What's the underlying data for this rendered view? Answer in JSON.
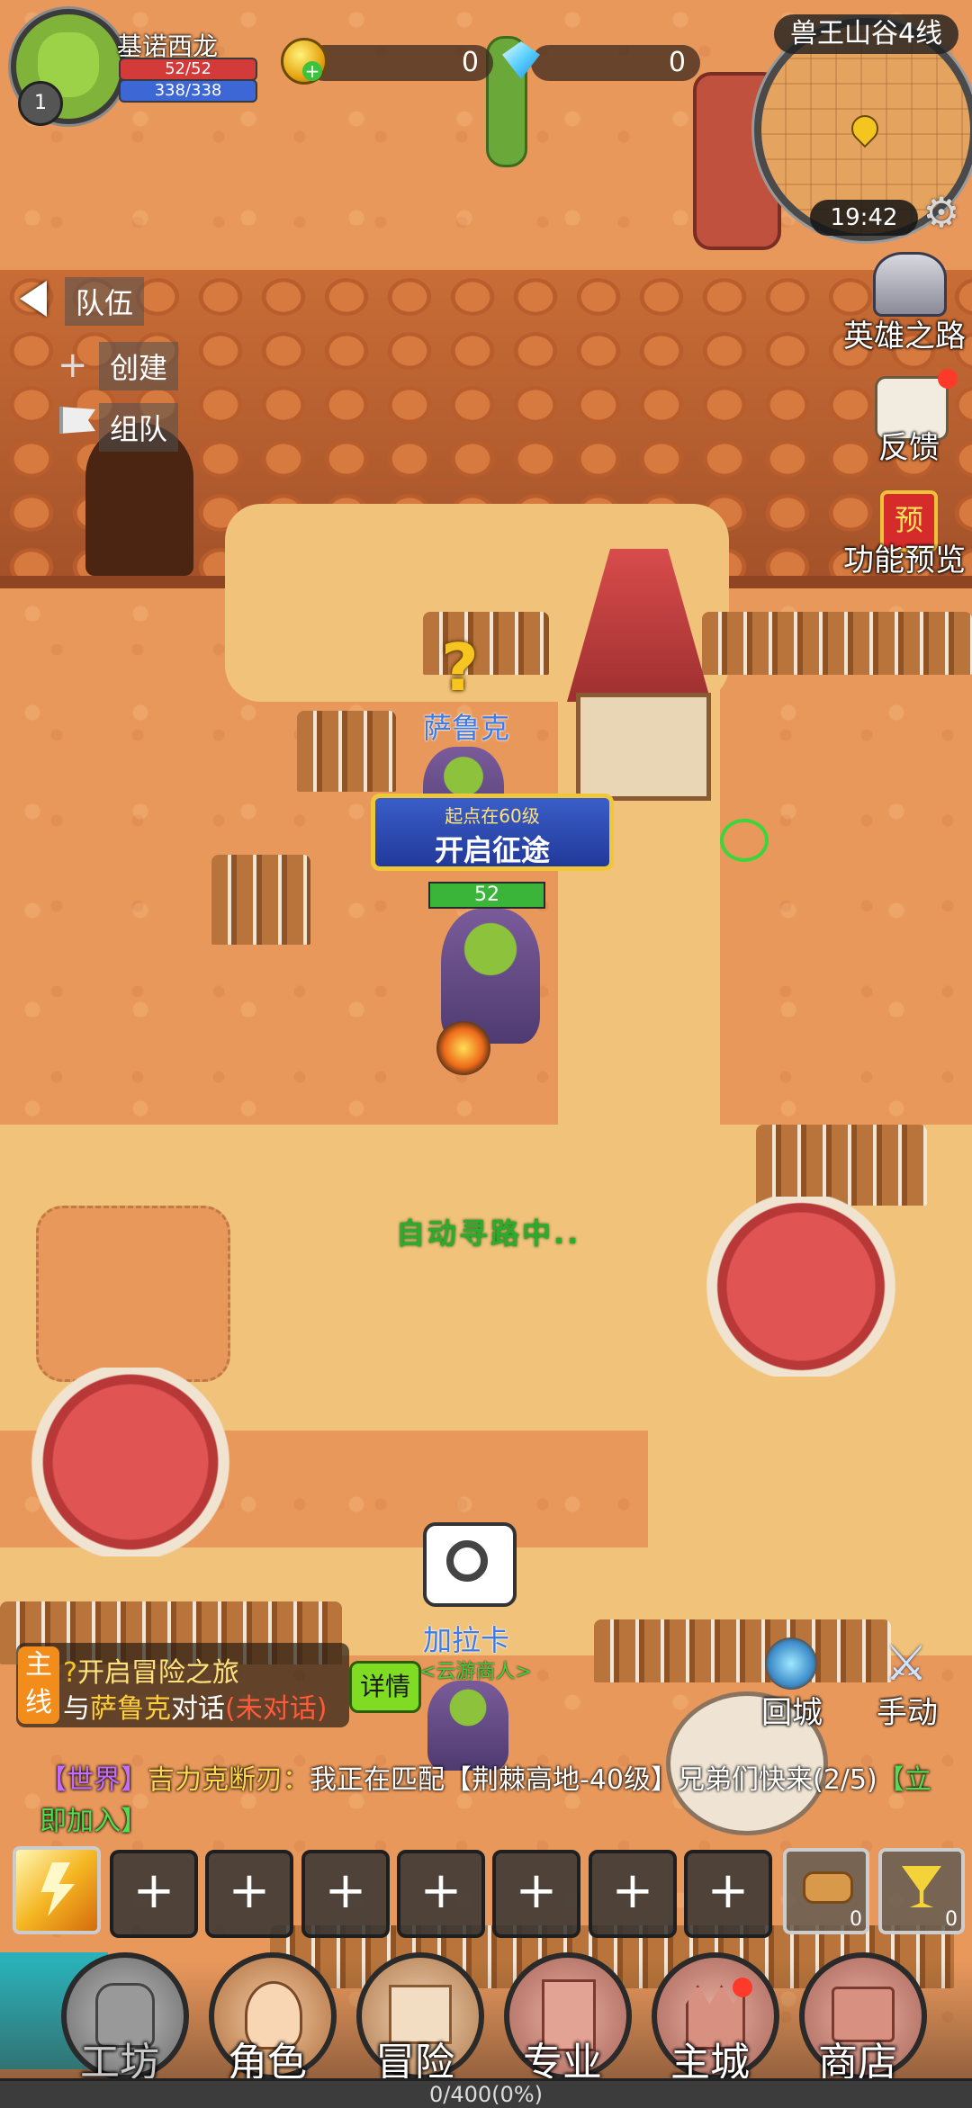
{
  "player": {
    "name": "基诺西龙",
    "hp": "52/52",
    "mp": "338/338",
    "level": "1"
  },
  "currency": {
    "gold": "0",
    "diamond": "0"
  },
  "map": {
    "name": "兽王山谷4线",
    "time": "19:42"
  },
  "side_menu": {
    "hero_road": "英雄之路",
    "feedback": "反馈",
    "preview": "功能预览",
    "preview_badge": "预"
  },
  "team": {
    "title": "队伍",
    "create": "创建",
    "join": "组队"
  },
  "npc_saruk": {
    "name": "萨鲁克",
    "marker": "?"
  },
  "banner": {
    "line1": "起点在60级",
    "line2": "开启征途"
  },
  "hero": {
    "hp_value": "52"
  },
  "status": {
    "auto_path": "自动寻路中.."
  },
  "npc_galaka": {
    "name": "加拉卡",
    "title": "<云游商人>"
  },
  "quest": {
    "tag": "主线",
    "title": "开启冒险之旅",
    "prefix": "与",
    "npc": "萨鲁克",
    "action": "对话",
    "state": "(未对话)",
    "details_btn": "详情",
    "marker": "?"
  },
  "actions": {
    "return_city": "回城",
    "manual": "手动"
  },
  "chat": {
    "channel": "【世界】",
    "sender": "吉力克断刃：",
    "message": "我正在匹配【荆棘高地-40级】兄弟们快来(2/5)",
    "join": "【立即加入】"
  },
  "skill_slots": [
    "+",
    "+",
    "+",
    "+",
    "+",
    "+",
    "+"
  ],
  "items": [
    {
      "count": "0"
    },
    {
      "count": "0"
    }
  ],
  "bottom_nav": [
    "工坊",
    "角色",
    "冒险",
    "专业",
    "主城",
    "商店"
  ],
  "xp": "0/400(0%)",
  "colors": {
    "hp": "#d33a3a",
    "mp": "#3e67d6",
    "quest_tag": "#f28d1b",
    "auto_path": "#2aad2a",
    "npc_name": "#3d7be6"
  }
}
